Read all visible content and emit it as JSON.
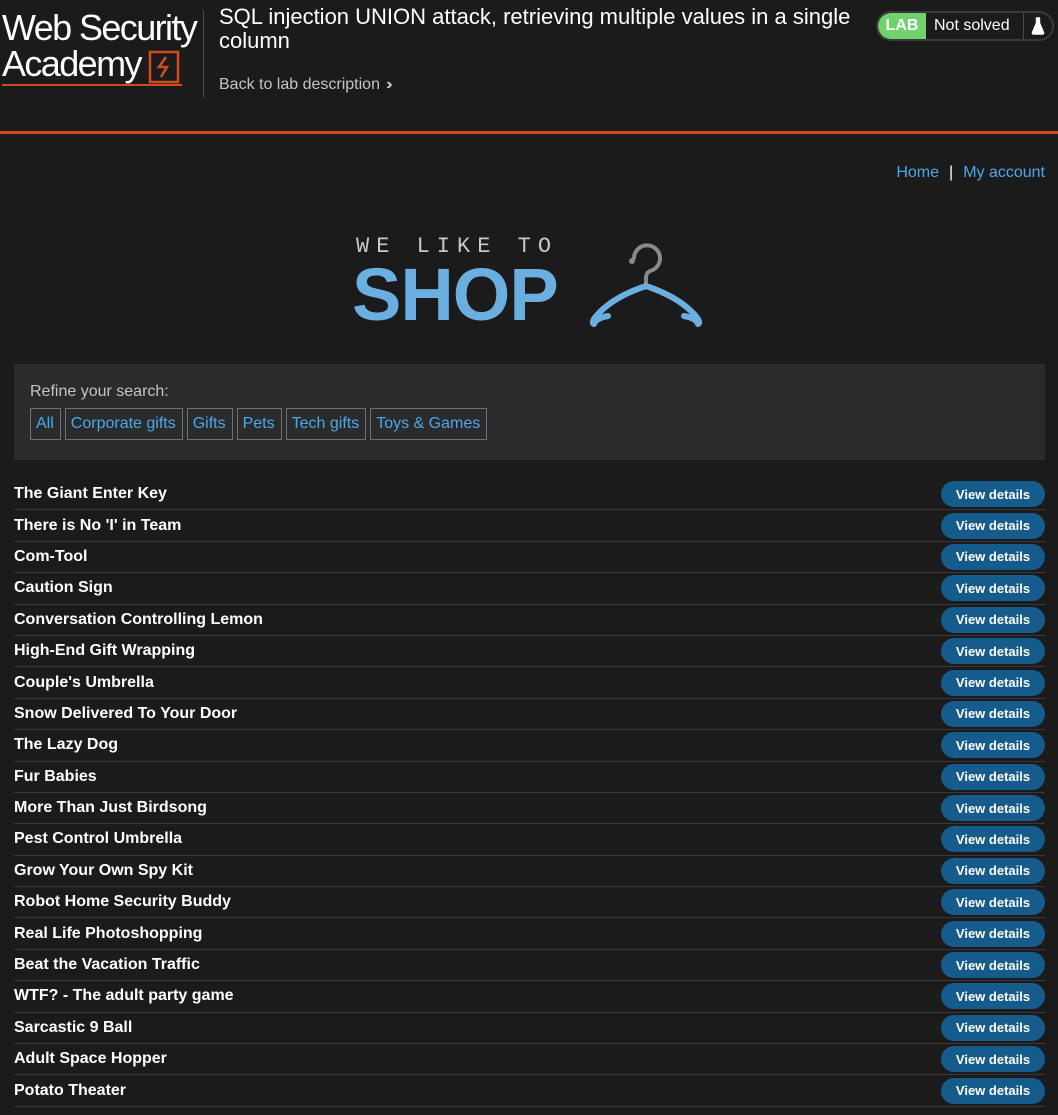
{
  "header": {
    "logo_line1": "Web Security",
    "logo_line2": "Academy",
    "lab_title": "SQL injection UNION attack, retrieving multiple values in a single column",
    "back_link": "Back to lab description",
    "lab_badge": "LAB",
    "lab_status": "Not solved",
    "accent_color": "#d04c1f",
    "status_color": "#70d16d"
  },
  "nav": {
    "home": "Home",
    "separator": "|",
    "my_account": "My account"
  },
  "banner": {
    "tagline": "WE LIKE TO",
    "title": "SHOP",
    "icon": "hanger-icon"
  },
  "filter": {
    "label": "Refine your search:",
    "categories": [
      "All",
      "Corporate gifts",
      "Gifts",
      "Pets",
      "Tech gifts",
      "Toys & Games"
    ]
  },
  "products": {
    "button_label": "View details",
    "items": [
      "The Giant Enter Key",
      "There is No 'I' in Team",
      "Com-Tool",
      "Caution Sign",
      "Conversation Controlling Lemon",
      "High-End Gift Wrapping",
      "Couple's Umbrella",
      "Snow Delivered To Your Door",
      "The Lazy Dog",
      "Fur Babies",
      "More Than Just Birdsong",
      "Pest Control Umbrella",
      "Grow Your Own Spy Kit",
      "Robot Home Security Buddy",
      "Real Life Photoshopping",
      "Beat the Vacation Traffic",
      "WTF? - The adult party game",
      "Sarcastic 9 Ball",
      "Adult Space Hopper",
      "Potato Theater"
    ]
  }
}
